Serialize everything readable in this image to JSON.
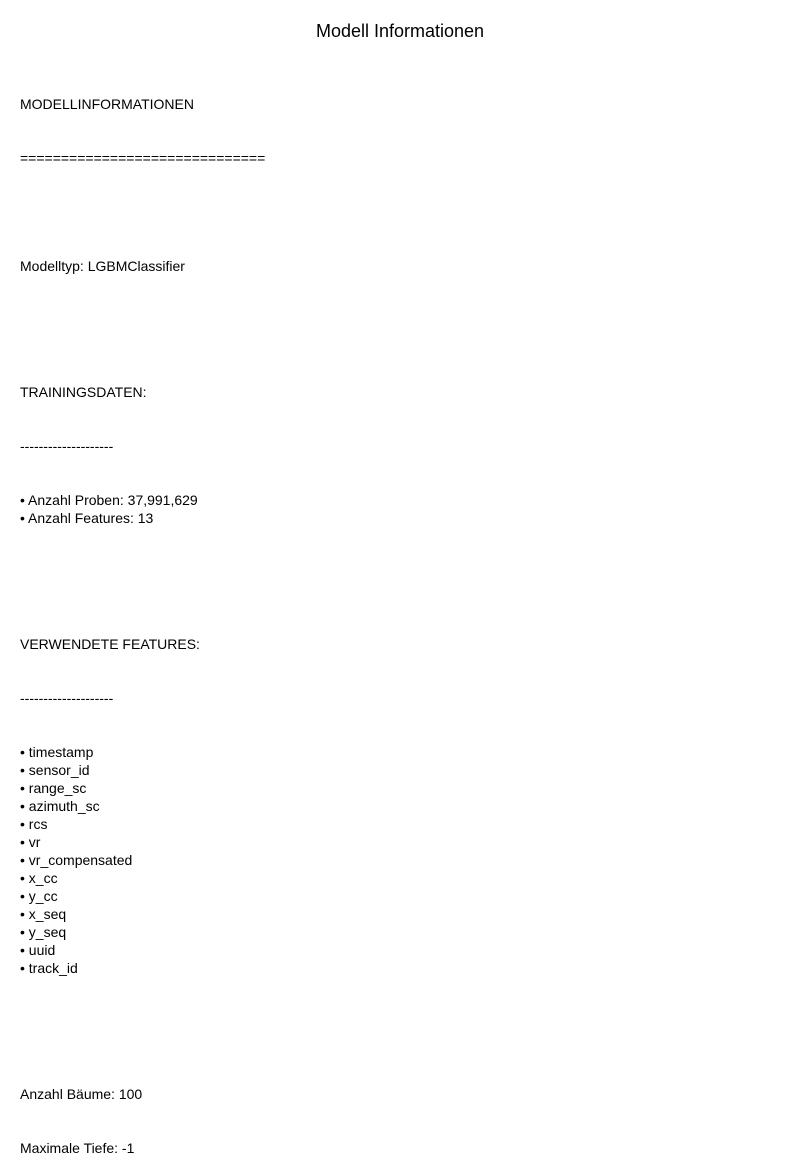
{
  "title": "Modell Informationen",
  "report": {
    "heading": "MODELLINFORMATIONEN",
    "heading_rule": "==============================",
    "model_type": "Modelltyp: LGBMClassifier",
    "training": {
      "heading": "TRAININGSDATEN:",
      "rule": "--------------------",
      "items": [
        "Anzahl Proben: 37,991,629",
        "Anzahl Features: 13"
      ]
    },
    "features": {
      "heading": "VERWENDETE FEATURES:",
      "rule": "--------------------",
      "items": [
        "timestamp",
        "sensor_id",
        "range_sc",
        "azimuth_sc",
        "rcs",
        "vr",
        "vr_compensated",
        "x_cc",
        "y_cc",
        "x_seq",
        "y_seq",
        "uuid",
        "track_id"
      ]
    },
    "num_trees": "Anzahl Bäume: 100",
    "max_depth": "Maximale Tiefe: -1"
  },
  "bullet_glyph": "• "
}
